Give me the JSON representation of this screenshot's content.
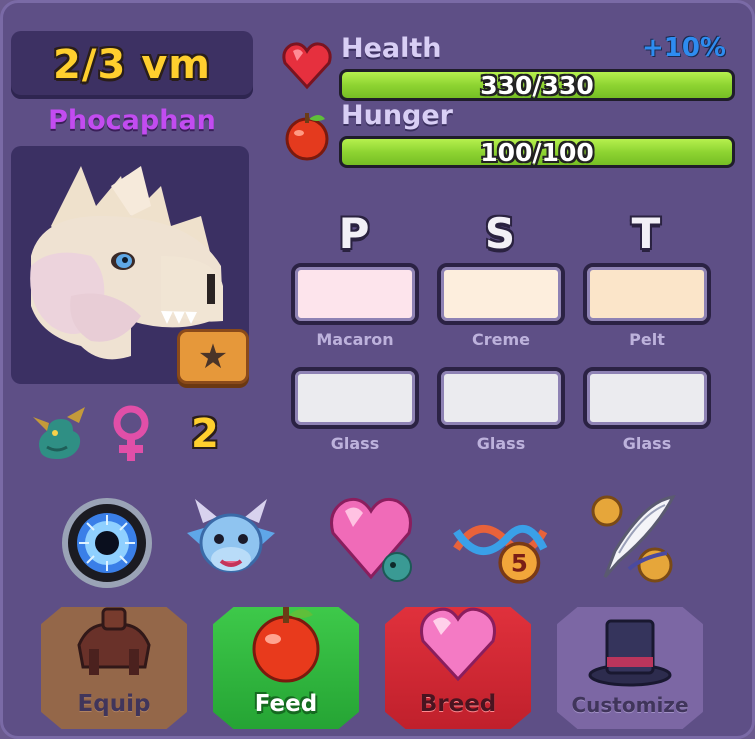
{
  "header": {
    "title": "2/3 vm",
    "species": "Phocaphan"
  },
  "stats": {
    "health": {
      "label": "Health",
      "value": "330/330",
      "fill": 1.0,
      "bonus": "+10%"
    },
    "hunger": {
      "label": "Hunger",
      "value": "100/100",
      "fill": 1.0
    }
  },
  "info": {
    "level": "2",
    "gender": "female"
  },
  "genes": {
    "headers": [
      "P",
      "S",
      "T"
    ],
    "rows": [
      [
        {
          "name": "Macaron",
          "color": "#fde4ec"
        },
        {
          "name": "Creme",
          "color": "#fdeedd"
        },
        {
          "name": "Pelt",
          "color": "#fbe5c9"
        }
      ],
      [
        {
          "name": "Glass",
          "color": "#ebebef"
        },
        {
          "name": "Glass",
          "color": "#ebebef"
        },
        {
          "name": "Glass",
          "color": "#ebebef"
        }
      ]
    ]
  },
  "actions": [
    "eye-orb-icon",
    "dragon-face-icon",
    "heart-gem-icon",
    "dna-level-icon",
    "quill-icon"
  ],
  "dna_badge": "5",
  "buttons": {
    "equip": "Equip",
    "feed": "Feed",
    "breed": "Breed",
    "customize": "Customize"
  },
  "colors": {
    "title": "#ffcf2e",
    "species": "#c24cf0",
    "bonus": "#2e8cf0",
    "bar_fill": "#8ed432"
  }
}
